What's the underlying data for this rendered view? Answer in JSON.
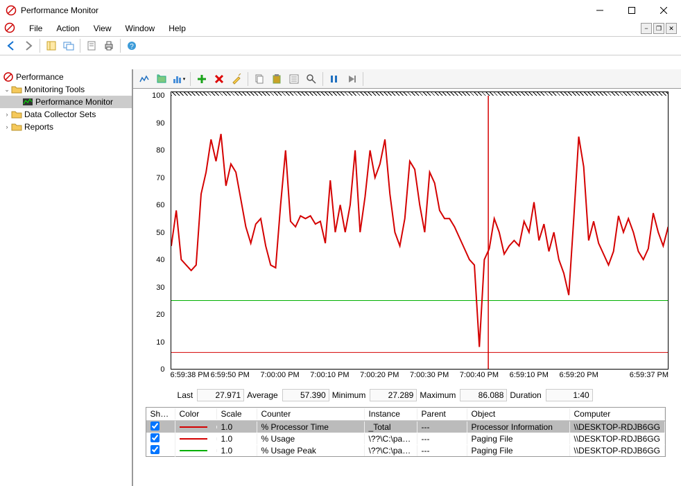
{
  "title": "Performance Monitor",
  "menus": [
    "File",
    "Action",
    "View",
    "Window",
    "Help"
  ],
  "tree": {
    "root": "Performance",
    "monitoring_tools": "Monitoring Tools",
    "perfmon": "Performance Monitor",
    "dcs": "Data Collector Sets",
    "reports": "Reports"
  },
  "chart_data": {
    "type": "line",
    "ylim": [
      0,
      100
    ],
    "yticks": [
      0,
      10,
      20,
      30,
      40,
      50,
      60,
      70,
      80,
      90,
      100
    ],
    "xlabels": [
      "6:59:38 PM",
      "6:59:50 PM",
      "7:00:00 PM",
      "7:00:10 PM",
      "7:00:20 PM",
      "7:00:30 PM",
      "7:00:40 PM",
      "6:59:10 PM",
      "6:59:20 PM",
      "6:59:37 PM"
    ],
    "xlabels_pos": [
      0,
      12,
      22,
      32,
      42,
      52,
      62,
      72,
      82,
      100
    ],
    "cursor_pos": 63.8,
    "series": [
      {
        "name": "% Processor Time",
        "color": "#d40000",
        "width": 2,
        "values": [
          45,
          58,
          40,
          38,
          36,
          38,
          64,
          72,
          84,
          76,
          86,
          67,
          75,
          72,
          62,
          52,
          46,
          53,
          55,
          45,
          38,
          37,
          60,
          80,
          54,
          52,
          56,
          55,
          56,
          53,
          54,
          46,
          69,
          50,
          60,
          50,
          60,
          80,
          50,
          63,
          80,
          70,
          75,
          84,
          64,
          50,
          45,
          55,
          76,
          73,
          60,
          50,
          72,
          68,
          58,
          55,
          55,
          52,
          48,
          44,
          40,
          38,
          8,
          40,
          44,
          55,
          50,
          42,
          45,
          47,
          45,
          54,
          50,
          61,
          47,
          53,
          43,
          50,
          40,
          35,
          27,
          55,
          85,
          74,
          47,
          54,
          46,
          42,
          38,
          43,
          56,
          50,
          55,
          50,
          43,
          40,
          44,
          57,
          50,
          45,
          52
        ]
      },
      {
        "name": "% Usage",
        "color": "#d40000",
        "width": 1,
        "values": [
          6,
          6,
          6,
          6,
          6,
          6,
          6,
          6,
          6,
          6,
          6,
          6,
          6,
          6,
          6,
          6,
          6,
          6,
          6,
          6,
          6,
          6,
          6,
          6,
          6,
          6,
          6,
          6,
          6,
          6,
          6,
          6,
          6,
          6,
          6,
          6,
          6,
          6,
          6,
          6,
          6,
          6,
          6,
          6,
          6,
          6,
          6,
          6,
          6,
          6,
          6,
          6,
          6,
          6,
          6,
          6,
          6,
          6,
          6,
          6,
          6,
          6,
          6,
          6,
          6,
          6,
          6,
          6,
          6,
          6,
          6,
          6,
          6,
          6,
          6,
          6,
          6,
          6,
          6,
          6,
          6,
          6,
          6,
          6,
          6,
          6,
          6,
          6,
          6,
          6,
          6,
          6,
          6,
          6,
          6,
          6,
          6,
          6,
          6,
          6,
          6
        ]
      },
      {
        "name": "% Usage Peak",
        "color": "#00b000",
        "width": 1,
        "values": [
          25,
          25,
          25,
          25,
          25,
          25,
          25,
          25,
          25,
          25,
          25,
          25,
          25,
          25,
          25,
          25,
          25,
          25,
          25,
          25,
          25,
          25,
          25,
          25,
          25,
          25,
          25,
          25,
          25,
          25,
          25,
          25,
          25,
          25,
          25,
          25,
          25,
          25,
          25,
          25,
          25,
          25,
          25,
          25,
          25,
          25,
          25,
          25,
          25,
          25,
          25,
          25,
          25,
          25,
          25,
          25,
          25,
          25,
          25,
          25,
          25,
          25,
          25,
          25,
          25,
          25,
          25,
          25,
          25,
          25,
          25,
          25,
          25,
          25,
          25,
          25,
          25,
          25,
          25,
          25,
          25,
          25,
          25,
          25,
          25,
          25,
          25,
          25,
          25,
          25,
          25,
          25,
          25,
          25,
          25,
          25,
          25,
          25,
          25,
          25,
          25
        ]
      }
    ]
  },
  "stats": {
    "labels": {
      "last": "Last",
      "average": "Average",
      "minimum": "Minimum",
      "maximum": "Maximum",
      "duration": "Duration"
    },
    "last": "27.971",
    "average": "57.390",
    "minimum": "27.289",
    "maximum": "86.088",
    "duration": "1:40"
  },
  "legend": {
    "headers": {
      "show": "Show",
      "color": "Color",
      "scale": "Scale",
      "counter": "Counter",
      "instance": "Instance",
      "parent": "Parent",
      "object": "Object",
      "computer": "Computer"
    },
    "rows": [
      {
        "checked": true,
        "color": "#d40000",
        "scale": "1.0",
        "counter": "% Processor Time",
        "instance": "_Total",
        "parent": "---",
        "object": "Processor Information",
        "computer": "\\\\DESKTOP-RDJB6GG",
        "sel": true
      },
      {
        "checked": true,
        "color": "#d40000",
        "scale": "1.0",
        "counter": "% Usage",
        "instance": "\\??\\C:\\pag...",
        "parent": "---",
        "object": "Paging File",
        "computer": "\\\\DESKTOP-RDJB6GG",
        "sel": false
      },
      {
        "checked": true,
        "color": "#00b000",
        "scale": "1.0",
        "counter": "% Usage Peak",
        "instance": "\\??\\C:\\pag...",
        "parent": "---",
        "object": "Paging File",
        "computer": "\\\\DESKTOP-RDJB6GG",
        "sel": false
      }
    ]
  }
}
